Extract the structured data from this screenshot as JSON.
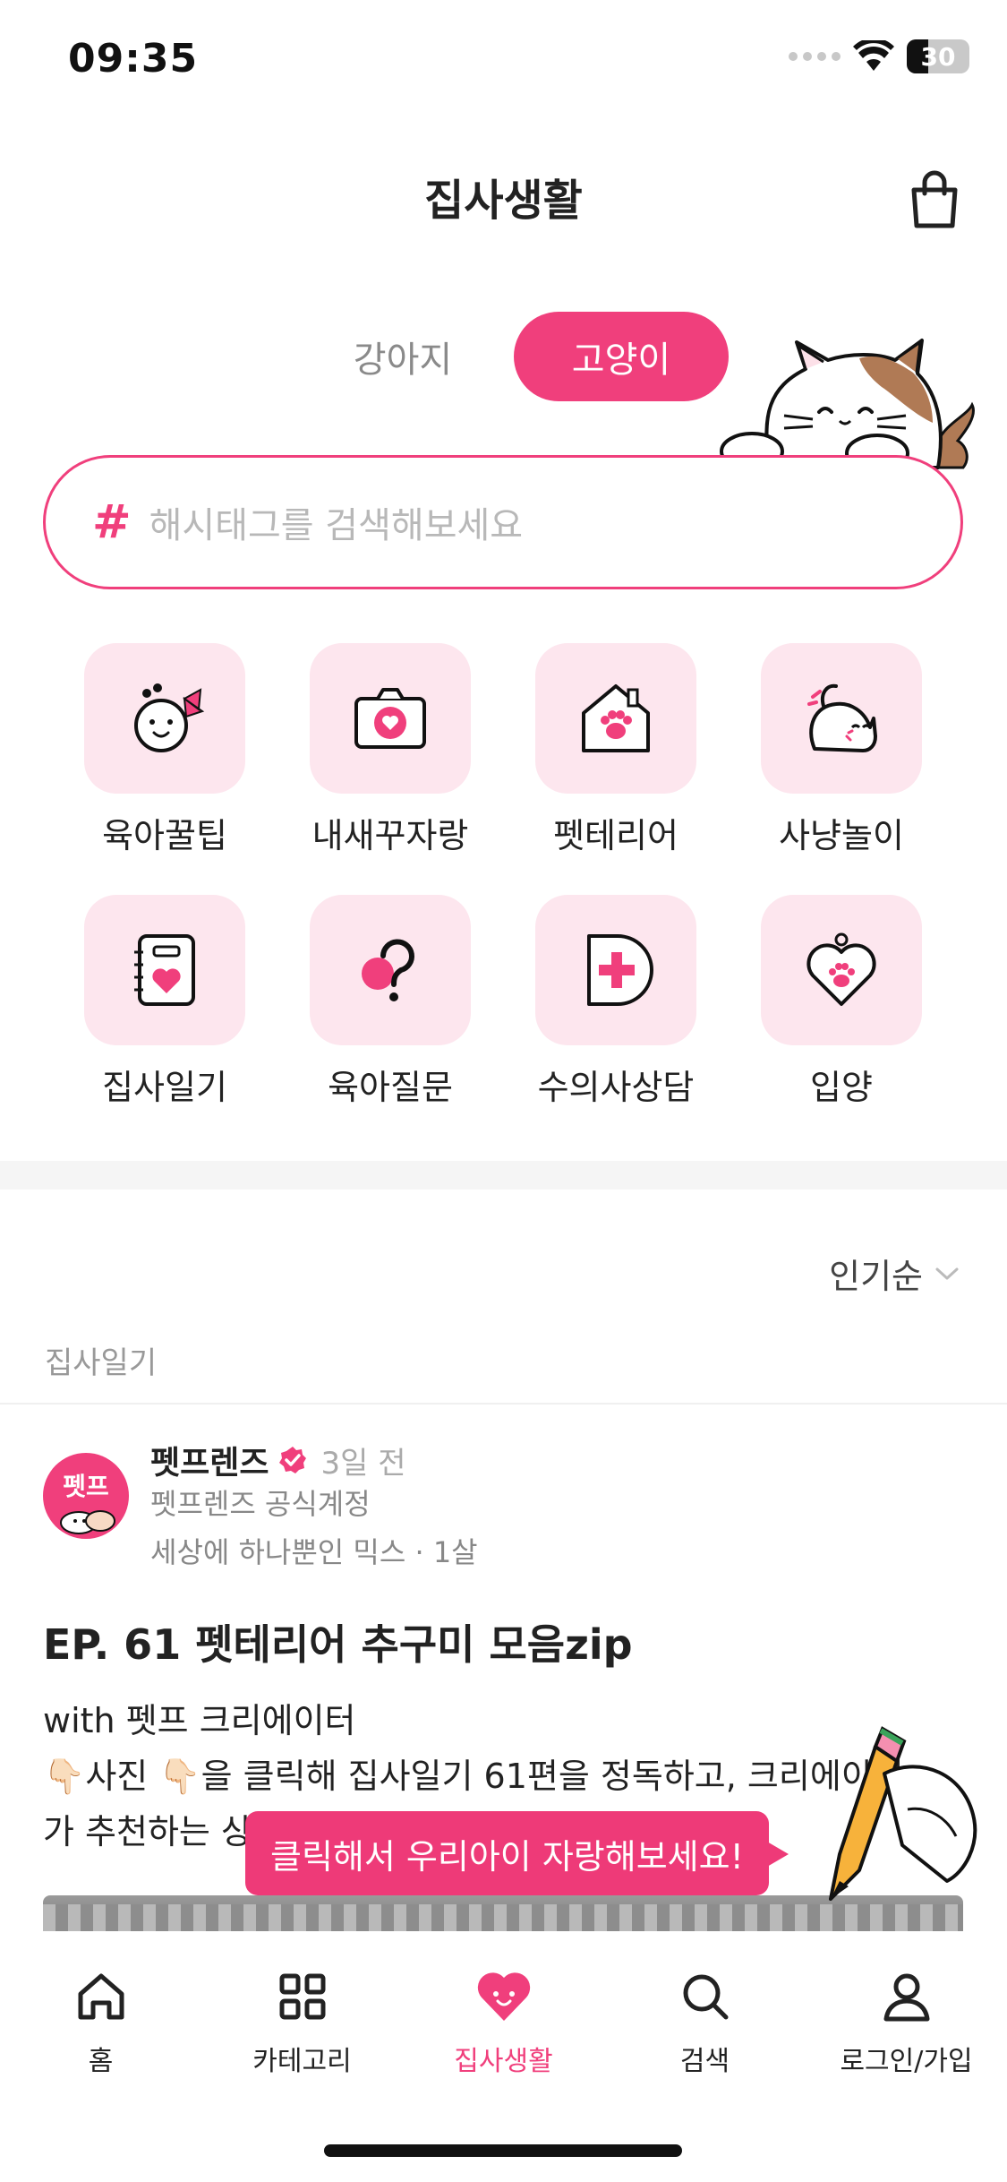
{
  "status_bar": {
    "time": "09:35",
    "battery": "30"
  },
  "header": {
    "title": "집사생활",
    "cart_icon": "shopping-bag-icon"
  },
  "pet_toggle": {
    "options": [
      "강아지",
      "고양이"
    ],
    "selected": "고양이"
  },
  "search": {
    "hash": "#",
    "placeholder": "해시태그를 검색해보세요"
  },
  "categories": [
    {
      "label": "육아꿀팁",
      "icon": "baby-face-icon"
    },
    {
      "label": "내새꾸자랑",
      "icon": "camera-heart-icon"
    },
    {
      "label": "펫테리어",
      "icon": "paw-house-icon"
    },
    {
      "label": "사냥놀이",
      "icon": "cat-play-icon"
    },
    {
      "label": "집사일기",
      "icon": "diary-heart-icon"
    },
    {
      "label": "육아질문",
      "icon": "question-icon"
    },
    {
      "label": "수의사상담",
      "icon": "medical-cross-icon"
    },
    {
      "label": "입양",
      "icon": "heart-paw-tag-icon"
    }
  ],
  "sort": {
    "label": "인기순"
  },
  "feed": {
    "category": "집사일기",
    "post": {
      "avatar_text": "펫프",
      "author": "펫프렌즈",
      "time": "3일 전",
      "author_desc": "펫프렌즈 공식계정",
      "pet_info": "세상에 하나뿐인 믹스 · 1살",
      "title": "EP. 61 펫테리어 추구미 모음zip",
      "body_lines": [
        "with 펫프 크리에이터",
        "👇🏻사진 👇🏻을 클릭해 집사일기 61편을 정독하고, 크리에이터",
        "가 추천하는 상품도 확인해보세요"
      ]
    }
  },
  "tooltip": {
    "text": "클릭해서 우리아이 자랑해보세요!"
  },
  "colors": {
    "accent": "#f03f7c",
    "icon_bg": "#fde6ee"
  },
  "bottom_nav": [
    {
      "label": "홈",
      "icon": "home-icon"
    },
    {
      "label": "카테고리",
      "icon": "grid-icon"
    },
    {
      "label": "집사생활",
      "icon": "heart-face-icon",
      "active": true
    },
    {
      "label": "검색",
      "icon": "search-icon"
    },
    {
      "label": "로그인/가입",
      "icon": "user-icon"
    }
  ]
}
